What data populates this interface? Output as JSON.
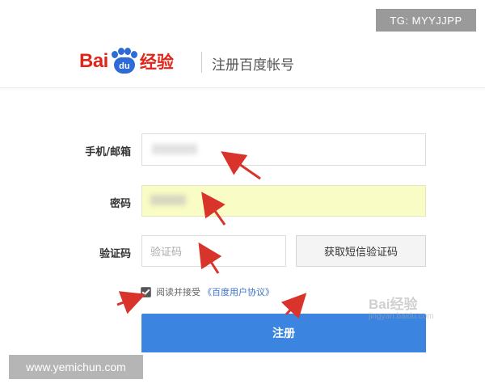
{
  "overlay": {
    "tg_label": "TG: MYYJJPP",
    "site_label": "www.yemichun.com"
  },
  "header": {
    "logo_bai": "Bai",
    "logo_du": "du",
    "logo_cn": "经验",
    "title": "注册百度帐号"
  },
  "form": {
    "phone_label": "手机/邮箱",
    "password_label": "密码",
    "captcha_label": "验证码",
    "captcha_placeholder": "验证码",
    "sms_button": "获取短信验证码",
    "agree_text": "阅读并接受",
    "agree_link": "《百度用户协议》",
    "agree_checked": true,
    "register_button": "注册"
  },
  "watermark": {
    "logo": "Bai经验",
    "sub": "jingyan.baidu.com"
  },
  "colors": {
    "brand_red": "#e1251b",
    "brand_blue": "#2f6bd6",
    "button_blue": "#3b84e0",
    "autofill_yellow": "#fafcc5",
    "arrow_red": "#d9342b"
  }
}
